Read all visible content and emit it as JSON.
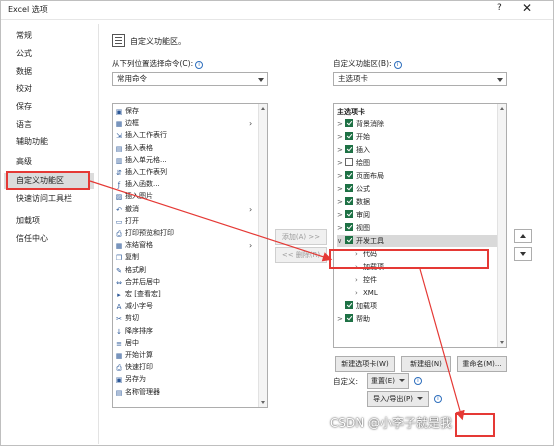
{
  "window": {
    "title": "Excel 选项",
    "help": "?",
    "close": "✕"
  },
  "nav": {
    "items": [
      "常规",
      "公式",
      "数据",
      "校对",
      "保存",
      "语言",
      "辅助功能",
      "高级",
      "自定义功能区",
      "快速访问工具栏",
      "加载项",
      "信任中心"
    ]
  },
  "header": {
    "title": "自定义功能区。"
  },
  "left_panel": {
    "label": "从下列位置选择命令(C):",
    "select_value": "常用命令",
    "commands": [
      {
        "label": "保存",
        "icon": "save-icon",
        "has_sub": false
      },
      {
        "label": "边框",
        "icon": "border-icon",
        "has_sub": true
      },
      {
        "label": "插入工作表行",
        "icon": "insert-rows-icon",
        "has_sub": false
      },
      {
        "label": "插入表格",
        "icon": "insert-table-icon",
        "has_sub": false
      },
      {
        "label": "插入单元格...",
        "icon": "insert-cells-icon",
        "has_sub": false
      },
      {
        "label": "插入工作表列",
        "icon": "insert-columns-icon",
        "has_sub": false
      },
      {
        "label": "插入函数...",
        "icon": "function-icon",
        "has_sub": false
      },
      {
        "label": "插入图片",
        "icon": "picture-icon",
        "has_sub": false
      },
      {
        "label": "撤消",
        "icon": "undo-icon",
        "has_sub": true
      },
      {
        "label": "打开",
        "icon": "open-icon",
        "has_sub": false
      },
      {
        "label": "打印预览和打印",
        "icon": "print-preview-icon",
        "has_sub": false
      },
      {
        "label": "冻结窗格",
        "icon": "freeze-panes-icon",
        "has_sub": true
      },
      {
        "label": "复制",
        "icon": "copy-icon",
        "has_sub": false
      },
      {
        "label": "格式刷",
        "icon": "format-painter-icon",
        "has_sub": false
      },
      {
        "label": "合并后居中",
        "icon": "merge-center-icon",
        "has_sub": false
      },
      {
        "label": "宏 [查看宏]",
        "icon": "macro-icon",
        "has_sub": false
      },
      {
        "label": "减小字号",
        "icon": "decrease-font-icon",
        "has_sub": false
      },
      {
        "label": "剪切",
        "icon": "cut-icon",
        "has_sub": false
      },
      {
        "label": "降序排序",
        "icon": "sort-desc-icon",
        "has_sub": false
      },
      {
        "label": "居中",
        "icon": "center-icon",
        "has_sub": false
      },
      {
        "label": "开始计算",
        "icon": "calculate-icon",
        "has_sub": false
      },
      {
        "label": "快速打印",
        "icon": "quick-print-icon",
        "has_sub": false
      },
      {
        "label": "另存为",
        "icon": "save-as-icon",
        "has_sub": false
      },
      {
        "label": "名称管理器",
        "icon": "name-manager-icon",
        "has_sub": false
      }
    ]
  },
  "middle": {
    "add": "添加(A) >>",
    "remove": "<< 删除(R)"
  },
  "right_panel": {
    "label": "自定义功能区(B):",
    "select_value": "主选项卡",
    "tree_header": "主选项卡",
    "tabs": [
      {
        "label": "背景消除",
        "checked": true,
        "expand": ">"
      },
      {
        "label": "开始",
        "checked": true,
        "expand": ">"
      },
      {
        "label": "插入",
        "checked": true,
        "expand": ">"
      },
      {
        "label": "绘图",
        "checked": false,
        "expand": ">"
      },
      {
        "label": "页面布局",
        "checked": true,
        "expand": ">"
      },
      {
        "label": "公式",
        "checked": true,
        "expand": ">"
      },
      {
        "label": "数据",
        "checked": true,
        "expand": ">"
      },
      {
        "label": "审阅",
        "checked": true,
        "expand": ">"
      },
      {
        "label": "视图",
        "checked": true,
        "expand": ">"
      },
      {
        "label": "开发工具",
        "checked": true,
        "expand": "∨"
      }
    ],
    "groups": [
      "代码",
      "加载项",
      "控件",
      "XML"
    ],
    "tail": [
      {
        "label": "加载项",
        "checked": true,
        "expand": ""
      },
      {
        "label": "帮助",
        "checked": true,
        "expand": ">"
      }
    ],
    "new_tab": "新建选项卡(W)",
    "new_group": "新建组(N)",
    "rename": "重命名(M)...",
    "custom_label": "自定义:",
    "reset": "重置(E)",
    "import_export": "导入/导出(P)"
  },
  "watermark": "CSDN @小李子就是我",
  "colors": {
    "highlight_red": "#e53935",
    "checkbox_green": "#1e7145",
    "info_blue": "#2f6fbd"
  }
}
